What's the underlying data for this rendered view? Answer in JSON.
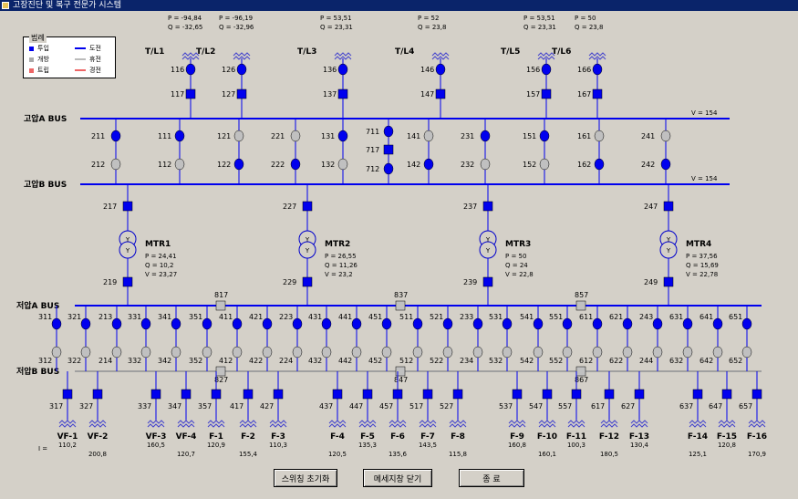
{
  "window": {
    "title": "고장진단 및 복구 전문가 시스템"
  },
  "legend": {
    "title": "범례",
    "items": [
      {
        "label": "투입",
        "kind": "box",
        "color": "#0000ee"
      },
      {
        "label": "개방",
        "kind": "box",
        "color": "#aaaaaa"
      },
      {
        "label": "트립",
        "kind": "box",
        "color": "#ee6666"
      },
      {
        "label": "도전",
        "kind": "line",
        "color": "#0000ee"
      },
      {
        "label": "휴전",
        "kind": "line",
        "color": "#bbbbbb"
      },
      {
        "label": "경전",
        "kind": "line",
        "color": "#ee6666"
      }
    ]
  },
  "colors": {
    "closed": "#0000ee",
    "open": "#c0c0c0",
    "bus_blue": "#0000ee",
    "bus_gray": "#a0a0a0"
  },
  "buses": {
    "hv_a": {
      "label": "고압A BUS",
      "voltage": "V = 154"
    },
    "hv_b": {
      "label": "고압B BUS",
      "voltage": "V = 154"
    },
    "lv_a": {
      "label": "저압A BUS"
    },
    "lv_b": {
      "label": "저압B BUS"
    }
  },
  "lines": [
    {
      "name": "T/L1",
      "p": "P = -94,84",
      "q": "Q = -32,65",
      "sw1": "116",
      "sw2": "117"
    },
    {
      "name": "T/L2",
      "p": "P = -96,19",
      "q": "Q = -32,96",
      "sw1": "126",
      "sw2": "127"
    },
    {
      "name": "T/L3",
      "p": "P = 53,51",
      "q": "Q = 23,31",
      "sw1": "136",
      "sw2": "137"
    },
    {
      "name": "T/L4",
      "p": "P = 52",
      "q": "Q = 23,8",
      "sw1": "146",
      "sw2": "147"
    },
    {
      "name": "T/L5",
      "p": "P = 53,51",
      "q": "Q = 23,31",
      "sw1": "156",
      "sw2": "157"
    },
    {
      "name": "T/L6",
      "p": "P = 50",
      "q": "Q = 23,8",
      "sw1": "166",
      "sw2": "167"
    }
  ],
  "hv_pairs": [
    {
      "a": "111",
      "b": "112",
      "a_closed": true,
      "b_closed": false
    },
    {
      "a": "121",
      "b": "122",
      "a_closed": false,
      "b_closed": true
    },
    {
      "a": "131",
      "b": "132",
      "a_closed": true,
      "b_closed": false
    },
    {
      "a": "141",
      "b": "142",
      "a_closed": false,
      "b_closed": true
    },
    {
      "a": "151",
      "b": "152",
      "a_closed": true,
      "b_closed": false
    },
    {
      "a": "161",
      "b": "162",
      "a_closed": false,
      "b_closed": true
    }
  ],
  "mtr_pairs": [
    {
      "a": "211",
      "b": "212",
      "a_closed": true,
      "b_closed": false
    },
    {
      "a": "221",
      "b": "222",
      "a_closed": false,
      "b_closed": true
    },
    {
      "a": "231",
      "b": "232",
      "a_closed": true,
      "b_closed": false
    },
    {
      "a": "241",
      "b": "242",
      "a_closed": false,
      "b_closed": true
    }
  ],
  "bus_tie": {
    "top": "711",
    "mid": "717",
    "bottom": "712"
  },
  "transformers": [
    {
      "name": "MTR1",
      "upper": "217",
      "lower": "219",
      "p": "P = 24,41",
      "q": "Q = 10,2",
      "v": "V = 23,27"
    },
    {
      "name": "MTR2",
      "upper": "227",
      "lower": "229",
      "p": "P = 26,55",
      "q": "Q = 11,26",
      "v": "V = 23,2"
    },
    {
      "name": "MTR3",
      "upper": "237",
      "lower": "239",
      "p": "P = 50",
      "q": "Q = 24",
      "v": "V = 22,8"
    },
    {
      "name": "MTR4",
      "upper": "247",
      "lower": "249",
      "p": "P = 37,56",
      "q": "Q = 15,69",
      "v": "V = 22,78"
    }
  ],
  "lv_tie": [
    {
      "a": "817",
      "b": "827"
    },
    {
      "a": "837",
      "b": "847"
    },
    {
      "a": "857",
      "b": "867"
    }
  ],
  "lv_pairs": [
    {
      "a": "311",
      "b": "312",
      "a_closed": true,
      "b_closed": false
    },
    {
      "a": "321",
      "b": "322",
      "a_closed": true,
      "b_closed": false
    },
    {
      "a": "213",
      "b": "214",
      "a_closed": true,
      "b_closed": false
    },
    {
      "a": "331",
      "b": "332",
      "a_closed": true,
      "b_closed": false
    },
    {
      "a": "341",
      "b": "342",
      "a_closed": true,
      "b_closed": false
    },
    {
      "a": "351",
      "b": "352",
      "a_closed": true,
      "b_closed": false
    },
    {
      "a": "411",
      "b": "412",
      "a_closed": true,
      "b_closed": false
    },
    {
      "a": "421",
      "b": "422",
      "a_closed": true,
      "b_closed": false
    },
    {
      "a": "223",
      "b": "224",
      "a_closed": true,
      "b_closed": false
    },
    {
      "a": "431",
      "b": "432",
      "a_closed": true,
      "b_closed": false
    },
    {
      "a": "441",
      "b": "442",
      "a_closed": true,
      "b_closed": false
    },
    {
      "a": "451",
      "b": "452",
      "a_closed": true,
      "b_closed": false
    },
    {
      "a": "511",
      "b": "512",
      "a_closed": true,
      "b_closed": false
    },
    {
      "a": "521",
      "b": "522",
      "a_closed": true,
      "b_closed": false
    },
    {
      "a": "233",
      "b": "234",
      "a_closed": true,
      "b_closed": false
    },
    {
      "a": "531",
      "b": "532",
      "a_closed": true,
      "b_closed": false
    },
    {
      "a": "541",
      "b": "542",
      "a_closed": true,
      "b_closed": false
    },
    {
      "a": "551",
      "b": "552",
      "a_closed": true,
      "b_closed": false
    },
    {
      "a": "611",
      "b": "612",
      "a_closed": true,
      "b_closed": false
    },
    {
      "a": "621",
      "b": "622",
      "a_closed": true,
      "b_closed": false
    },
    {
      "a": "243",
      "b": "244",
      "a_closed": true,
      "b_closed": false
    },
    {
      "a": "631",
      "b": "632",
      "a_closed": true,
      "b_closed": false
    },
    {
      "a": "641",
      "b": "642",
      "a_closed": true,
      "b_closed": false
    },
    {
      "a": "651",
      "b": "652",
      "a_closed": true,
      "b_closed": false
    }
  ],
  "feeders": [
    {
      "sw": "317",
      "name": "VF-1",
      "i": "110,2"
    },
    {
      "sw": "327",
      "name": "VF-2",
      "i": "200,8"
    },
    {
      "sw": "337",
      "name": "VF-3",
      "i": "160,5"
    },
    {
      "sw": "347",
      "name": "VF-4",
      "i": "120,7"
    },
    {
      "sw": "357",
      "name": "F-1",
      "i": "120,9"
    },
    {
      "sw": "417",
      "name": "F-2",
      "i": "155,4"
    },
    {
      "sw": "427",
      "name": "F-3",
      "i": "110,3"
    },
    {
      "sw": "437",
      "name": "F-4",
      "i": "120,5"
    },
    {
      "sw": "447",
      "name": "F-5",
      "i": "135,3"
    },
    {
      "sw": "457",
      "name": "F-6",
      "i": "135,6"
    },
    {
      "sw": "517",
      "name": "F-7",
      "i": "143,5"
    },
    {
      "sw": "527",
      "name": "F-8",
      "i": "115,8"
    },
    {
      "sw": "537",
      "name": "F-9",
      "i": "160,8"
    },
    {
      "sw": "547",
      "name": "F-10",
      "i": "160,1"
    },
    {
      "sw": "557",
      "name": "F-11",
      "i": "100,3"
    },
    {
      "sw": "617",
      "name": "F-12",
      "i": "180,5"
    },
    {
      "sw": "627",
      "name": "F-13",
      "i": "130,4"
    },
    {
      "sw": "637",
      "name": "F-14",
      "i": "125,1"
    },
    {
      "sw": "647",
      "name": "F-15",
      "i": "120,8"
    },
    {
      "sw": "657",
      "name": "F-16",
      "i": "170,9"
    }
  ],
  "current_label": "I =",
  "buttons": {
    "reset": "스위칭 초기화",
    "close_msg": "메세지창 닫기",
    "exit": "종 료"
  }
}
